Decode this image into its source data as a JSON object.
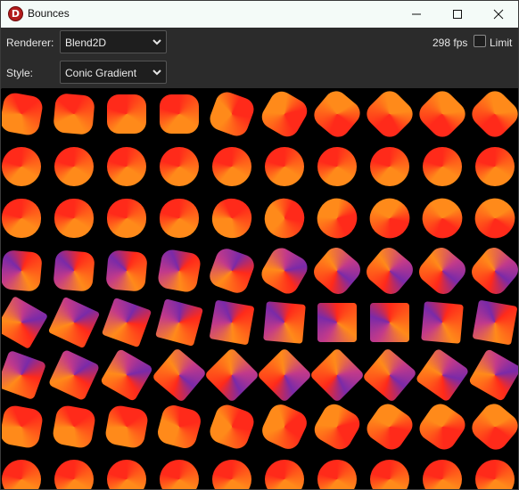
{
  "window": {
    "title": "Bounces",
    "app_icon_letter": "D"
  },
  "toolbar": {
    "renderer_label": "Renderer:",
    "renderer_value": "Blend2D",
    "fps": "298 fps",
    "limit_label": "Limit",
    "limit_checked": false
  },
  "style_bar": {
    "style_label": "Style:",
    "style_value": "Conic Gradient"
  },
  "canvas": {
    "background": "#000000",
    "shape_count_rows": 8,
    "shape_count_cols": 10,
    "gradient_colors": [
      "#ff2a1a",
      "#ff8a1a",
      "#c23a8a",
      "#7a2aa8"
    ]
  }
}
